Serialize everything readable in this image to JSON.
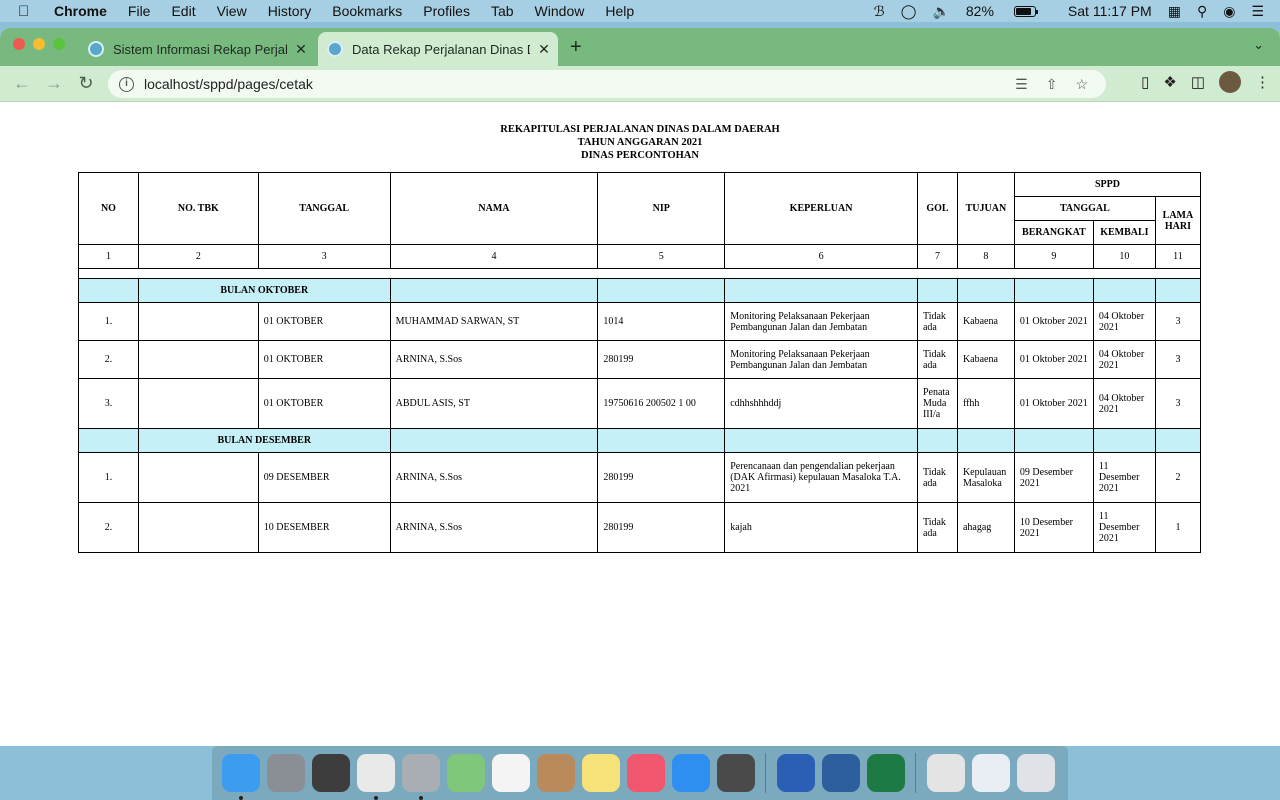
{
  "menubar": {
    "app_name": "Chrome",
    "items": [
      "File",
      "Edit",
      "View",
      "History",
      "Bookmarks",
      "Profiles",
      "Tab",
      "Window",
      "Help"
    ],
    "battery": "82%",
    "clock": "Sat 11:17 PM"
  },
  "browser": {
    "tabs": [
      {
        "title": "Sistem Informasi Rekap Perjalanan Dinas",
        "active": false
      },
      {
        "title": "Data Rekap Perjalanan Dinas Daerah",
        "active": true
      }
    ],
    "url": "localhost/sppd/pages/cetak"
  },
  "document": {
    "title_lines": [
      "REKAPITULASI PERJALANAN DINAS DALAM DAERAH",
      "TAHUN ANGGARAN 2021",
      "DINAS PERCONTOHAN"
    ],
    "headers": {
      "no": "NO",
      "no_tbk": "NO. TBK",
      "tanggal": "TANGGAL",
      "nama": "NAMA",
      "nip": "NIP",
      "keperluan": "KEPERLUAN",
      "gol": "GOL",
      "tujuan": "TUJUAN",
      "sppd": "SPPD",
      "sppd_tanggal": "TANGGAL",
      "berangkat": "BERANGKAT",
      "kembali": "KEMBALI",
      "lama_hari": "LAMA HARI"
    },
    "column_numbers": [
      "1",
      "2",
      "3",
      "4",
      "5",
      "6",
      "7",
      "8",
      "9",
      "10",
      "11"
    ],
    "groups": [
      {
        "month": "BULAN OKTOBER",
        "rows": [
          {
            "no": "1.",
            "no_tbk": "",
            "tanggal": "01 OKTOBER",
            "nama": "MUHAMMAD SARWAN, ST",
            "nip": "1014",
            "keperluan": "Monitoring Pelaksanaan Pekerjaan Pembangunan Jalan dan Jembatan",
            "gol": "Tidak ada",
            "tujuan": "Kabaena",
            "berangkat": "01 Oktober 2021",
            "kembali": "04 Oktober 2021",
            "lama": "3"
          },
          {
            "no": "2.",
            "no_tbk": "",
            "tanggal": "01 OKTOBER",
            "nama": "ARNINA, S.Sos",
            "nip": "280199",
            "keperluan": "Monitoring Pelaksanaan Pekerjaan Pembangunan Jalan dan Jembatan",
            "gol": "Tidak ada",
            "tujuan": "Kabaena",
            "berangkat": "01 Oktober 2021",
            "kembali": "04 Oktober 2021",
            "lama": "3"
          },
          {
            "no": "3.",
            "no_tbk": "",
            "tanggal": "01 OKTOBER",
            "nama": "ABDUL ASIS, ST",
            "nip": "19750616 200502 1 00",
            "keperluan": "cdhhshhhddj",
            "gol": "Penata Muda III/a",
            "tujuan": "ffhh",
            "berangkat": "01 Oktober 2021",
            "kembali": "04 Oktober 2021",
            "lama": "3"
          }
        ]
      },
      {
        "month": "BULAN DESEMBER",
        "rows": [
          {
            "no": "1.",
            "no_tbk": "",
            "tanggal": "09 DESEMBER",
            "nama": "ARNINA, S.Sos",
            "nip": "280199",
            "keperluan": "Perencanaan dan pengendalian pekerjaan (DAK Afirmasi) kepulauan Masaloka T.A. 2021",
            "gol": "Tidak ada",
            "tujuan": "Kepulauan Masaloka",
            "berangkat": "09 Desember 2021",
            "kembali": "11 Desember 2021",
            "lama": "2"
          },
          {
            "no": "2.",
            "no_tbk": "",
            "tanggal": "10 DESEMBER",
            "nama": "ARNINA, S.Sos",
            "nip": "280199",
            "keperluan": "kajah",
            "gol": "Tidak ada",
            "tujuan": "ahagag",
            "berangkat": "10 Desember 2021",
            "kembali": "11 Desember 2021",
            "lama": "1"
          }
        ]
      }
    ]
  },
  "dock": {
    "items": [
      {
        "name": "finder-icon",
        "color": "#3b9cf0",
        "running": true
      },
      {
        "name": "launchpad-icon",
        "color": "#8a8f96",
        "running": false
      },
      {
        "name": "sublime-text-icon",
        "color": "#3d3d3d",
        "running": false
      },
      {
        "name": "chrome-icon",
        "color": "#e9e9e9",
        "running": true
      },
      {
        "name": "system-preferences-icon",
        "color": "#a9aeb5",
        "running": true
      },
      {
        "name": "maps-icon",
        "color": "#7fc77a",
        "running": false
      },
      {
        "name": "photos-icon",
        "color": "#f4f4f4",
        "running": false
      },
      {
        "name": "contacts-icon",
        "color": "#b88a5c",
        "running": false
      },
      {
        "name": "notes-icon",
        "color": "#f7e27a",
        "running": false
      },
      {
        "name": "music-icon",
        "color": "#f0566e",
        "running": false
      },
      {
        "name": "app-store-icon",
        "color": "#2f8ff0",
        "running": false
      },
      {
        "name": "compressor-icon",
        "color": "#4a4a4a",
        "running": false
      },
      {
        "name": "separator",
        "color": "",
        "running": false
      },
      {
        "name": "word-icon",
        "color": "#2b5fb5",
        "running": false
      },
      {
        "name": "quicktime-icon",
        "color": "#2d5f9e",
        "running": false
      },
      {
        "name": "excel-icon",
        "color": "#1d7a45",
        "running": false
      },
      {
        "name": "separator",
        "color": "",
        "running": false
      },
      {
        "name": "music-folder-icon",
        "color": "#e4e4e4",
        "running": false
      },
      {
        "name": "documents-folder-icon",
        "color": "#e8eef4",
        "running": false
      },
      {
        "name": "trash-icon",
        "color": "#dfe3e8",
        "running": false
      }
    ]
  }
}
